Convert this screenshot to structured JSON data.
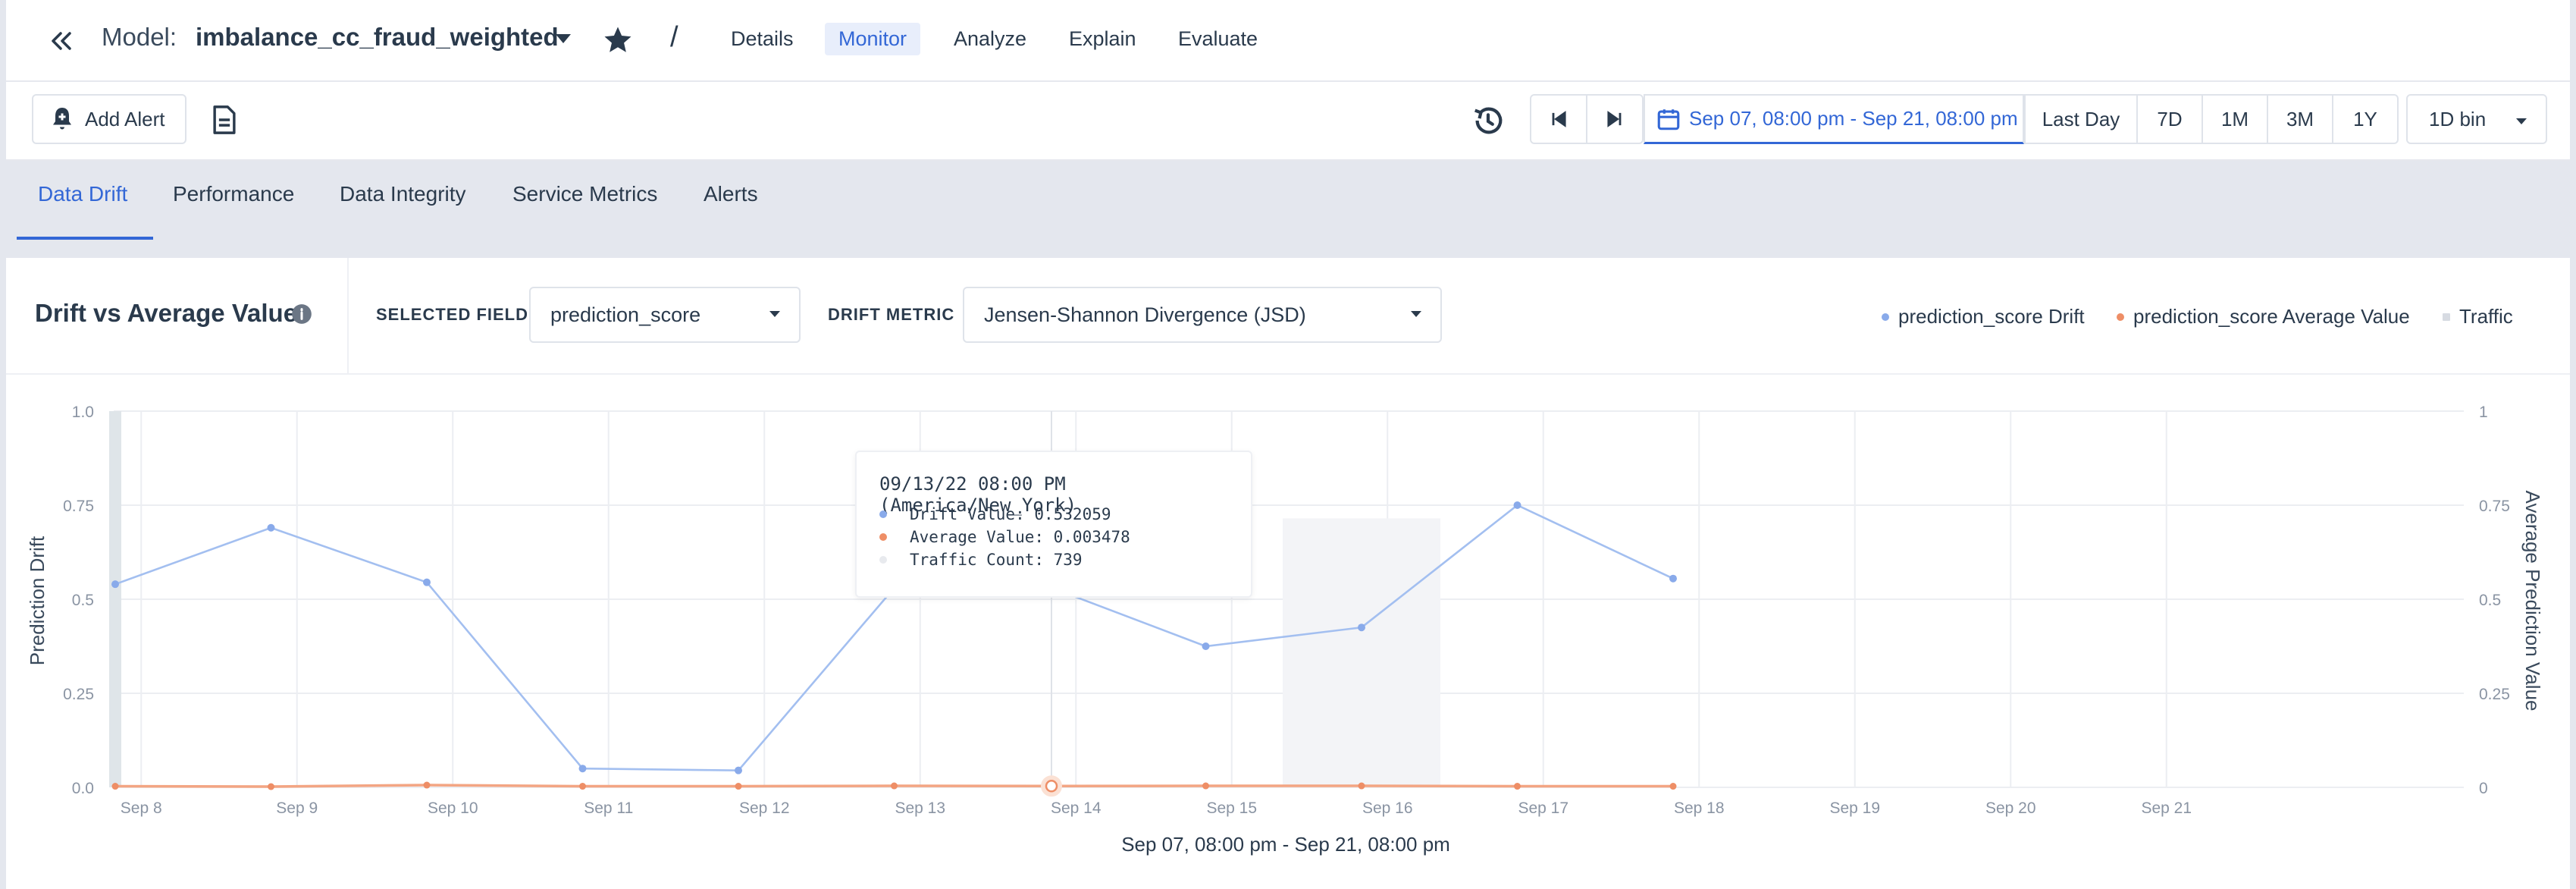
{
  "header": {
    "model_prefix": "Model:",
    "model_name": "imbalance_cc_fraud_weighted",
    "separator": "/",
    "nav": [
      {
        "label": "Details",
        "active": false
      },
      {
        "label": "Monitor",
        "active": true
      },
      {
        "label": "Analyze",
        "active": false
      },
      {
        "label": "Explain",
        "active": false
      },
      {
        "label": "Evaluate",
        "active": false
      }
    ]
  },
  "toolbar": {
    "add_alert_label": "Add Alert",
    "date_range_label": "Sep 07, 08:00 pm - Sep 21, 08:00 pm",
    "ranges": [
      "Last Day",
      "7D",
      "1M",
      "3M",
      "1Y"
    ],
    "bin_label": "1D bin"
  },
  "subtabs": [
    "Data Drift",
    "Performance",
    "Data Integrity",
    "Service Metrics",
    "Alerts"
  ],
  "panel": {
    "title": "Drift vs Average Value",
    "selected_field_label": "SELECTED FIELD",
    "selected_field_value": "prediction_score",
    "drift_metric_label": "DRIFT METRIC",
    "drift_metric_value": "Jensen-Shannon Divergence (JSD)"
  },
  "colors": {
    "accent": "#3367d6",
    "drift": "#a3bff0",
    "drift_marker": "#89aaea",
    "average": "#f3a583",
    "average_marker": "#ee8e66",
    "traffic": "#e3e5ea"
  },
  "tooltip": {
    "title": "09/13/22 08:00 PM (America/New_York)",
    "drift_label": "Drift Value: 0.532059",
    "average_label": "Average Value: 0.003478",
    "traffic_label": "Traffic Count: 739"
  },
  "chart_data": {
    "type": "line",
    "title": "Drift vs Average Value",
    "xlabel": "Sep 07, 08:00 pm - Sep 21, 08:00 pm",
    "ylabel": "Prediction Drift",
    "y2label": "Average Prediction Value",
    "ylim": [
      0,
      1
    ],
    "y2lim": [
      0,
      1
    ],
    "y_ticks": [
      "0.0",
      "0.25",
      "0.5",
      "0.75",
      "1.0"
    ],
    "y2_ticks": [
      "0",
      "0.25",
      "0.5",
      "0.75",
      "1"
    ],
    "x_ticks": [
      "Sep 8",
      "Sep 9",
      "Sep 10",
      "Sep 11",
      "Sep 12",
      "Sep 13",
      "Sep 14",
      "Sep 15",
      "Sep 16",
      "Sep 17",
      "Sep 18",
      "Sep 19",
      "Sep 20",
      "Sep 21"
    ],
    "x": [
      "Sep 07 8PM",
      "Sep 08 8PM",
      "Sep 09 8PM",
      "Sep 10 8PM",
      "Sep 11 8PM",
      "Sep 12 8PM",
      "Sep 13 8PM",
      "Sep 14 8PM",
      "Sep 15 8PM",
      "Sep 16 8PM",
      "Sep 17 8PM"
    ],
    "series": [
      {
        "name": "prediction_score Drift",
        "axis": "left",
        "values": [
          0.54,
          0.69,
          0.545,
          0.05,
          0.045,
          0.53,
          0.532059,
          0.375,
          0.425,
          0.75,
          0.555
        ]
      },
      {
        "name": "prediction_score Average Value",
        "axis": "right",
        "values": [
          0.003,
          0.002,
          0.006,
          0.003,
          0.003,
          0.004,
          0.003478,
          0.004,
          0.004,
          0.003,
          0.003
        ]
      }
    ],
    "traffic_series_name": "Traffic",
    "grid": true,
    "legend": "top-right",
    "highlighted_x": "Sep 13 8PM"
  }
}
